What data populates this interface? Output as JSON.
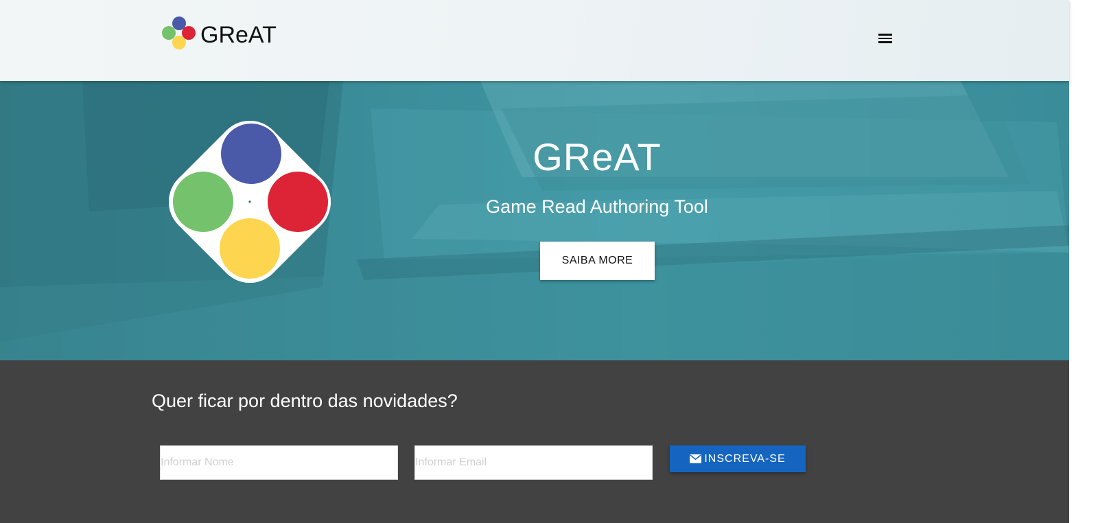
{
  "navbar": {
    "brand_title": "GReAT",
    "menu_icon": "hamburger-menu-icon"
  },
  "hero": {
    "title": "GReAT",
    "subtitle": "Game Read Authoring Tool",
    "cta_label": "SAIBA MORE"
  },
  "newsletter": {
    "heading": "Quer ficar por dentro das novidades?",
    "name_placeholder": "Informar Nome",
    "name_value": "",
    "email_placeholder": "Informar Email",
    "email_value": "",
    "subscribe_label": "INSCREVA-SE",
    "subscribe_icon": "envelope-icon"
  },
  "colors": {
    "logo_blue": "#4a5aa8",
    "logo_red": "#dd2336",
    "logo_green": "#74c26b",
    "logo_yellow": "#fdd54e",
    "hero_teal": "#3b8d9a",
    "newsletter_bg": "#424242",
    "subscribe_blue": "#1565c0"
  }
}
